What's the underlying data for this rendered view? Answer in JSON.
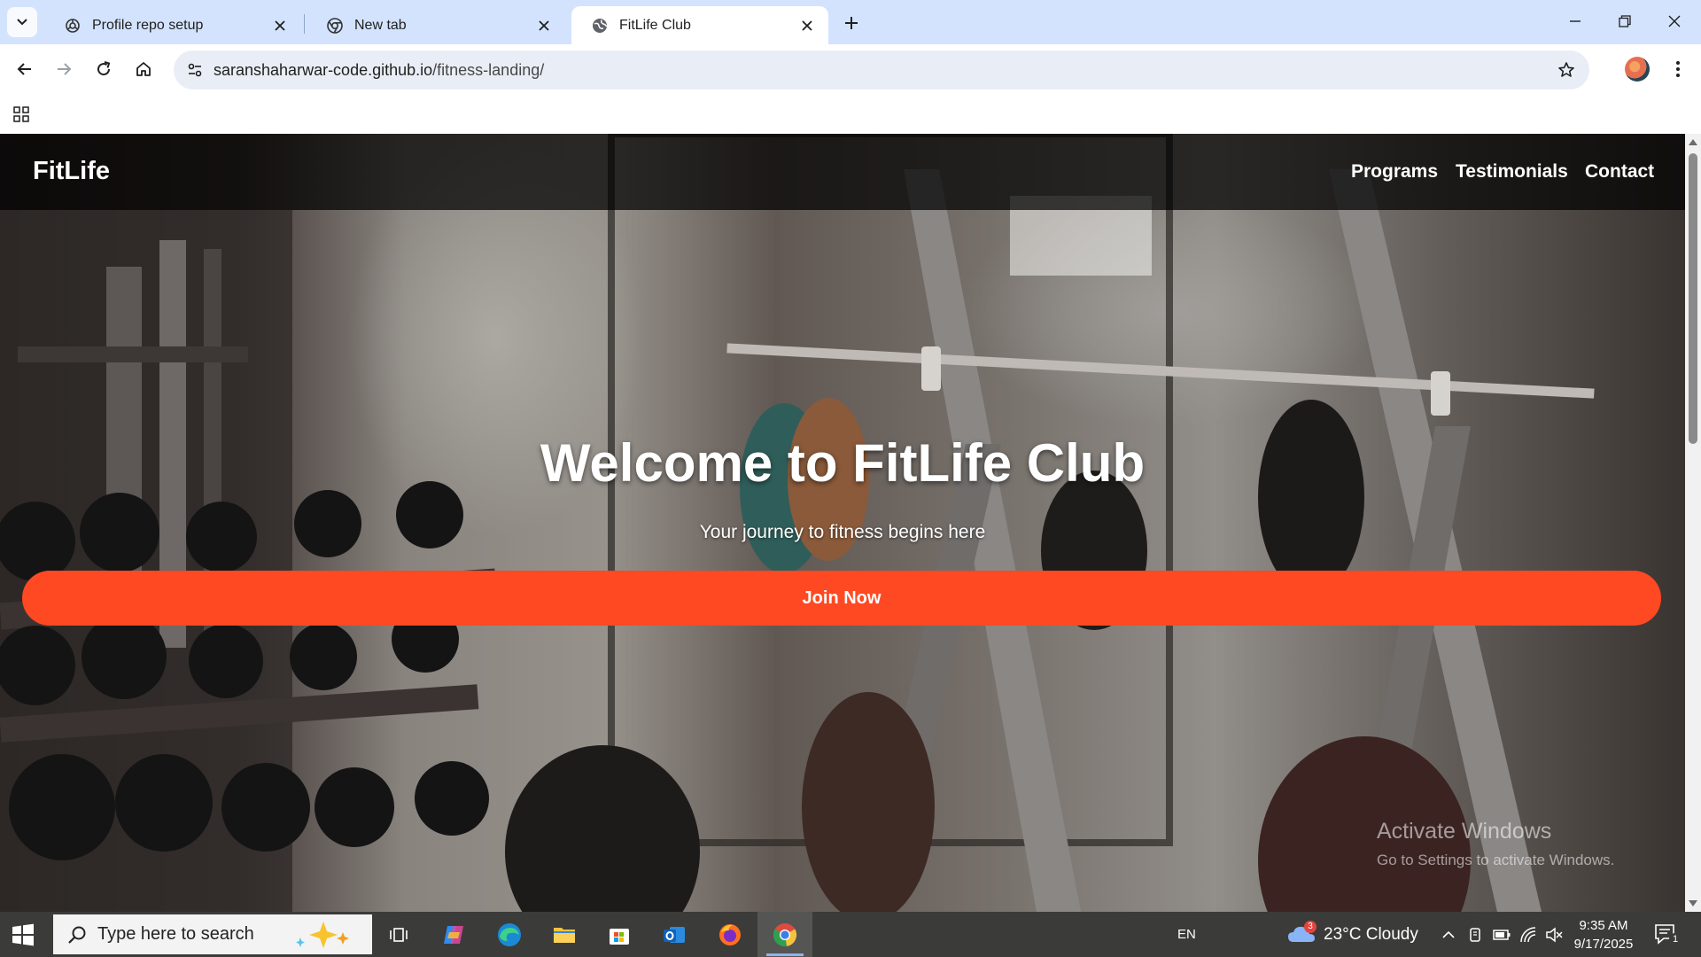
{
  "browser": {
    "tabs": [
      {
        "title": "Profile repo setup",
        "icon": "openai-icon",
        "active": false
      },
      {
        "title": "New tab",
        "icon": "chrome-icon",
        "active": false
      },
      {
        "title": "FitLife Club",
        "icon": "globe-icon",
        "active": true
      }
    ],
    "url_host": "saranshaharwar-code.github.io",
    "url_path": "/fitness-landing/"
  },
  "page": {
    "brand": "FitLife",
    "nav": [
      "Programs",
      "Testimonials",
      "Contact"
    ],
    "hero_title": "Welcome to FitLife Club",
    "hero_subtitle": "Your journey to fitness begins here",
    "cta_label": "Join Now",
    "accent_color": "#ff4922"
  },
  "watermark": {
    "line1": "Activate Windows",
    "line2": "Go to Settings to activate Windows."
  },
  "taskbar": {
    "search_placeholder": "Type here to search",
    "pinned": [
      "task-view-icon",
      "copilot-icon",
      "edge-icon",
      "file-explorer-icon",
      "microsoft-store-icon",
      "outlook-icon",
      "firefox-icon",
      "chrome-icon"
    ],
    "language": "EN",
    "weather_badge": "3",
    "weather": "23°C  Cloudy",
    "time": "9:35 AM",
    "date": "9/17/2025",
    "notification_count": "1"
  }
}
